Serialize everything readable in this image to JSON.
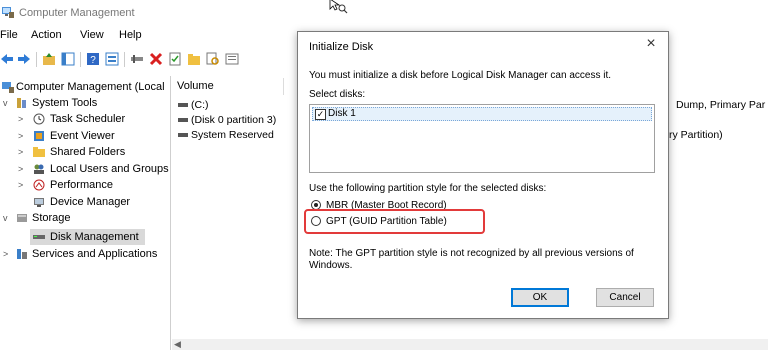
{
  "window": {
    "title": "Computer Management"
  },
  "menu": [
    "File",
    "Action",
    "View",
    "Help"
  ],
  "tree": [
    {
      "label": "Computer Management (Local",
      "level": 0,
      "chevron": "",
      "icon": "computer-management-icon"
    },
    {
      "label": "System Tools",
      "level": 1,
      "chevron": "v",
      "icon": "system-tools-icon"
    },
    {
      "label": "Task Scheduler",
      "level": 2,
      "chevron": ">",
      "icon": "clock-icon"
    },
    {
      "label": "Event Viewer",
      "level": 2,
      "chevron": ">",
      "icon": "event-viewer-icon"
    },
    {
      "label": "Shared Folders",
      "level": 2,
      "chevron": ">",
      "icon": "folder-icon"
    },
    {
      "label": "Local Users and Groups",
      "level": 2,
      "chevron": ">",
      "icon": "users-icon"
    },
    {
      "label": "Performance",
      "level": 2,
      "chevron": ">",
      "icon": "performance-icon"
    },
    {
      "label": "Device Manager",
      "level": 2,
      "chevron": "",
      "icon": "device-manager-icon"
    },
    {
      "label": "Storage",
      "level": 1,
      "chevron": "v",
      "icon": "storage-icon"
    },
    {
      "label": "Disk Management",
      "level": 2,
      "chevron": "",
      "icon": "disk-icon",
      "selected": true
    },
    {
      "label": "Services and Applications",
      "level": 1,
      "chevron": ">",
      "icon": "services-icon"
    }
  ],
  "volumes": {
    "header": "Volume",
    "rows": [
      "(C:)",
      "(Disk 0 partition 3)",
      "System Reserved"
    ],
    "right_col_text": [
      "Dump, Primary Par",
      "",
      "ry Partition)"
    ]
  },
  "dialog": {
    "title": "Initialize Disk",
    "close": "×",
    "message": "You must initialize a disk before Logical Disk Manager can access it.",
    "select_label": "Select disks:",
    "disks": [
      {
        "label": "Disk 1",
        "checked": true
      }
    ],
    "style_label": "Use the following partition style for the selected disks:",
    "mbr_label": "MBR (Master Boot Record)",
    "gpt_label": "GPT (GUID Partition Table)",
    "mbr_selected": true,
    "note": "Note: The GPT partition style is not recognized by all previous versions of Windows.",
    "ok_label": "OK",
    "cancel_label": "Cancel",
    "check_mark": "✓",
    "highlight_color": "#e23a3a"
  }
}
